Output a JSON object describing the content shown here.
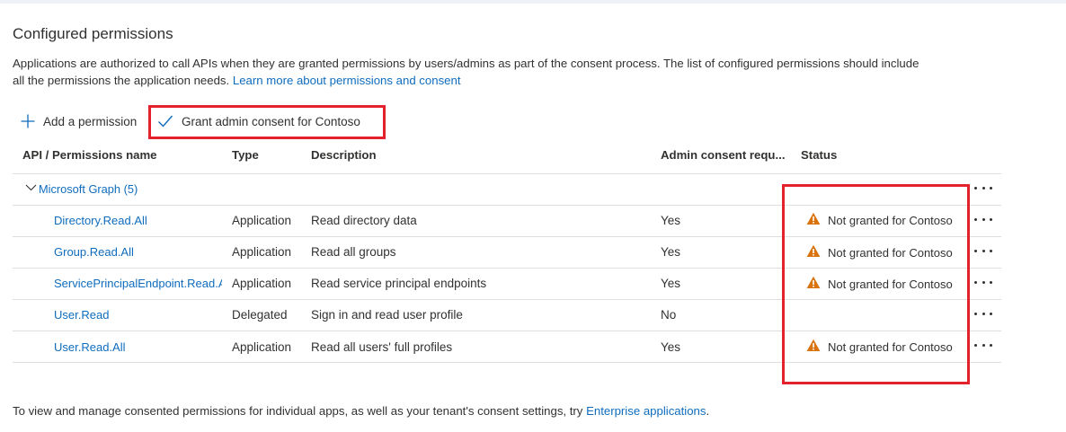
{
  "section": {
    "title": "Configured permissions",
    "description_line1": "Applications are authorized to call APIs when they are granted permissions by users/admins as part of the consent process. The list of configured permissions should include",
    "description_line2": "all the permissions the application needs.",
    "learn_more_link": "Learn more about permissions and consent"
  },
  "toolbar": {
    "add_permission_label": "Add a permission",
    "grant_consent_label": "Grant admin consent for Contoso"
  },
  "table": {
    "headers": {
      "api": "API / Permissions name",
      "type": "Type",
      "description": "Description",
      "admin_consent": "Admin consent requ...",
      "status": "Status"
    },
    "group": {
      "label": "Microsoft Graph (5)"
    },
    "rows": [
      {
        "name": "Directory.Read.All",
        "type": "Application",
        "description": "Read directory data",
        "admin_consent": "Yes",
        "status": "Not granted for Contoso"
      },
      {
        "name": "Group.Read.All",
        "type": "Application",
        "description": "Read all groups",
        "admin_consent": "Yes",
        "status": "Not granted for Contoso"
      },
      {
        "name": "ServicePrincipalEndpoint.Read.A",
        "type": "Application",
        "description": "Read service principal endpoints",
        "admin_consent": "Yes",
        "status": "Not granted for Contoso"
      },
      {
        "name": "User.Read",
        "type": "Delegated",
        "description": "Sign in and read user profile",
        "admin_consent": "No",
        "status": ""
      },
      {
        "name": "User.Read.All",
        "type": "Application",
        "description": "Read all users' full profiles",
        "admin_consent": "Yes",
        "status": "Not granted for Contoso"
      }
    ]
  },
  "footer": {
    "text": "To view and manage consented permissions for individual apps, as well as your tenant's consent settings, try",
    "link": "Enterprise applications",
    "end": "."
  },
  "icons": {
    "add": "plus-icon",
    "grant": "checkmark-icon",
    "group_toggle": "chevron-down-icon",
    "status_warning": "warning-icon",
    "more": "more-options-icon"
  },
  "colors": {
    "link": "#0f6cbd",
    "warning": "#d9730d",
    "highlight": "#e3222d"
  }
}
